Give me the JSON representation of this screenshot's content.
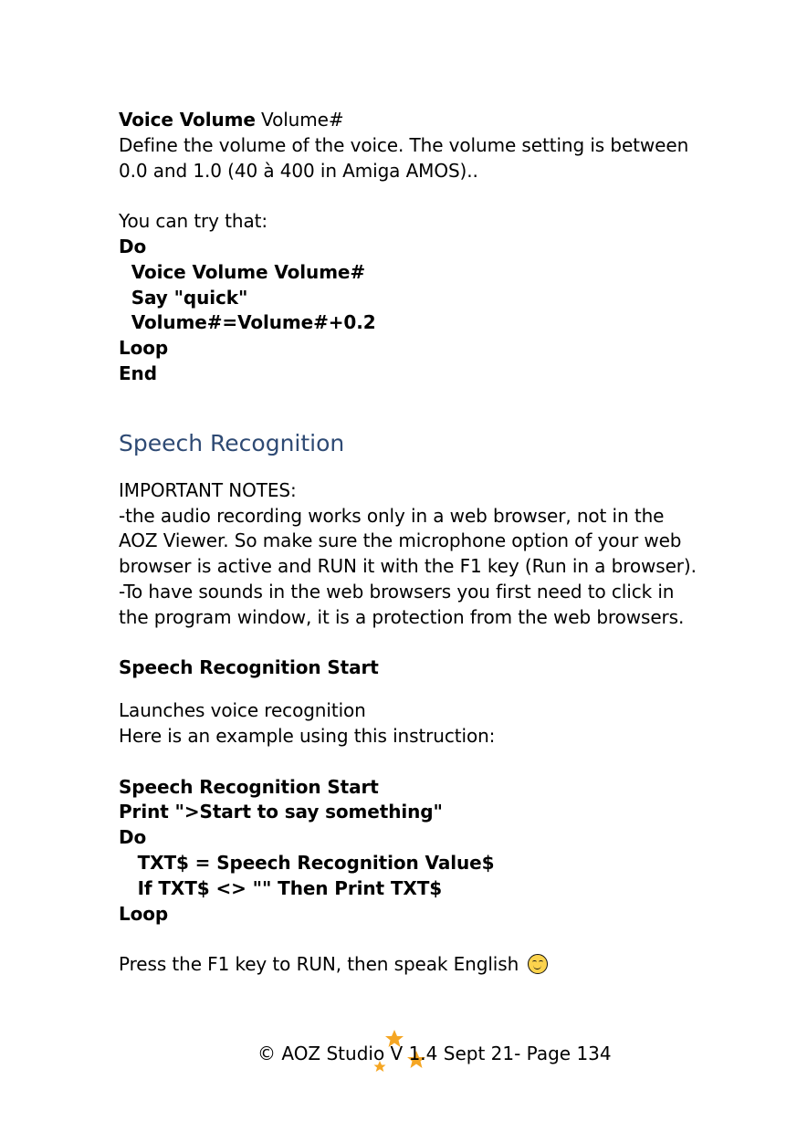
{
  "voice_volume": {
    "command": "Voice Volume",
    "param": " Volume#",
    "desc": [
      "Define the volume of the voice. The volume setting is between",
      "0.0 and 1.0 (40 à 400 in Amiga AMOS).."
    ],
    "try_intro": "You can try that:",
    "code": [
      "Do",
      "  Voice Volume Volume#",
      "  Say \"quick\"",
      "  Volume#=Volume#+0.2",
      "Loop",
      "End"
    ]
  },
  "speech": {
    "heading": "Speech Recognition",
    "notes": [
      "IMPORTANT NOTES:",
      "-the audio recording works only in a web browser, not in the",
      "AOZ Viewer. So make sure the microphone option of your web",
      "browser is active and RUN it with the F1 key (Run in a browser).",
      "-To have sounds in the web browsers you first need to click in",
      "the program window, it is a protection from the web browsers."
    ],
    "command_title": "Speech Recognition Start",
    "desc": [
      "Launches voice recognition",
      "Here is an example using this instruction:"
    ],
    "code": [
      "Speech Recognition Start",
      "Print \">Start to say something\"",
      "Do",
      "   TXT$ = Speech Recognition Value$",
      "   If TXT$ <> \"\" Then Print TXT$",
      "Loop"
    ],
    "closing": "Press the F1 key to RUN, then speak English",
    "emoji": "smiling-face-icon"
  },
  "footer": {
    "text": "© AOZ Studio V 1.4 Sept 21- Page 134",
    "star_color": "#f5a623"
  }
}
